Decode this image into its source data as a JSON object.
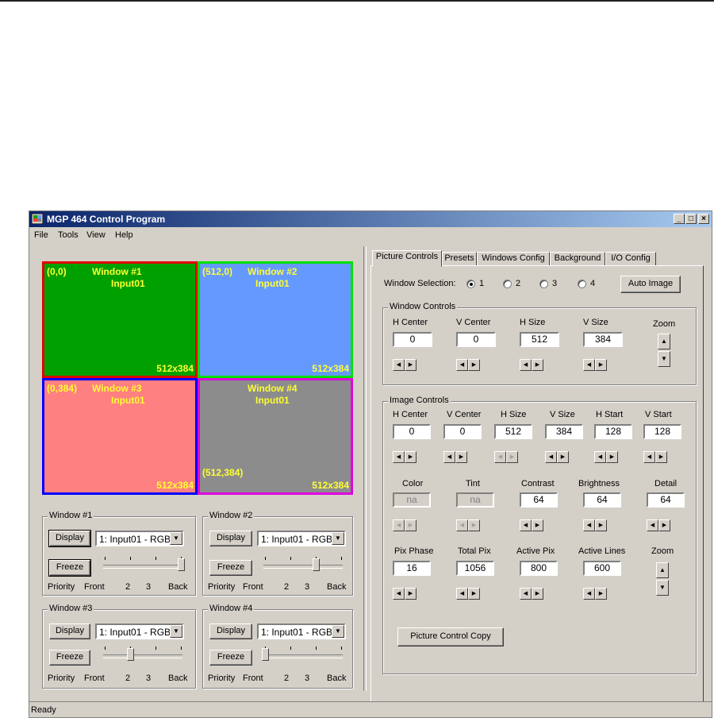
{
  "window": {
    "title": "MGP 464 Control Program",
    "buttons": {
      "minimize": "_",
      "maximize": "□",
      "close": "×"
    }
  },
  "menu": [
    "File",
    "Tools",
    "View",
    "Help"
  ],
  "preview": {
    "windows": [
      {
        "coord": "(0,0)",
        "name": "Window #1",
        "input": "Input01",
        "size": "512x384",
        "fill": "#00a000",
        "border": "#e00000"
      },
      {
        "coord": "(512,0)",
        "name": "Window #2",
        "input": "Input01",
        "size": "512x384",
        "fill": "#6699ff",
        "border": "#00e000"
      },
      {
        "coord": "(0,384)",
        "name": "Window #3",
        "input": "Input01",
        "size": "512x384",
        "fill": "#ff8080",
        "border": "#0000ff"
      },
      {
        "coord": "(512,384)",
        "name": "Window #4",
        "input": "Input01",
        "size": "512x384",
        "fill": "#8c8c8c",
        "border": "#e000e0"
      }
    ]
  },
  "window_groups": [
    {
      "legend": "Window #1",
      "display": "Display",
      "input": "1: Input01 - RGB",
      "freeze": "Freeze",
      "priority_level": 4
    },
    {
      "legend": "Window #2",
      "display": "Display",
      "input": "1: Input01 - RGB",
      "freeze": "Freeze",
      "priority_level": 3
    },
    {
      "legend": "Window #3",
      "display": "Display",
      "input": "1: Input01 - RGB",
      "freeze": "Freeze",
      "priority_level": 2
    },
    {
      "legend": "Window #4",
      "display": "Display",
      "input": "1: Input01 - RGB",
      "freeze": "Freeze",
      "priority_level": 1
    }
  ],
  "priority_labels": {
    "priority": "Priority",
    "front": "Front",
    "two": "2",
    "three": "3",
    "back": "Back"
  },
  "tabs": [
    "Picture Controls",
    "Presets",
    "Windows Config",
    "Background",
    "I/O Config"
  ],
  "window_selection": {
    "label": "Window Selection:",
    "options": [
      "1",
      "2",
      "3",
      "4"
    ],
    "selected": "1"
  },
  "auto_image": "Auto Image",
  "window_controls": {
    "legend": "Window Controls",
    "fields": [
      {
        "label": "H Center",
        "value": "0"
      },
      {
        "label": "V Center",
        "value": "0"
      },
      {
        "label": "H Size",
        "value": "512"
      },
      {
        "label": "V Size",
        "value": "384"
      }
    ],
    "zoom": "Zoom"
  },
  "image_controls": {
    "legend": "Image Controls",
    "row1": [
      {
        "label": "H Center",
        "value": "0"
      },
      {
        "label": "V Center",
        "value": "0"
      },
      {
        "label": "H Size",
        "value": "512"
      },
      {
        "label": "V Size",
        "value": "384"
      },
      {
        "label": "H Start",
        "value": "128"
      },
      {
        "label": "V Start",
        "value": "128"
      }
    ],
    "row2": [
      {
        "label": "Color",
        "value": "na"
      },
      {
        "label": "Tint",
        "value": "na"
      },
      {
        "label": "Contrast",
        "value": "64"
      },
      {
        "label": "Brightness",
        "value": "64"
      },
      {
        "label": "Detail",
        "value": "64"
      }
    ],
    "row3": [
      {
        "label": "Pix Phase",
        "value": "16"
      },
      {
        "label": "Total Pix",
        "value": "1056"
      },
      {
        "label": "Active Pix",
        "value": "800"
      },
      {
        "label": "Active Lines",
        "value": "600"
      }
    ],
    "zoom": "Zoom",
    "copy_button": "Picture Control Copy"
  },
  "status": "Ready"
}
